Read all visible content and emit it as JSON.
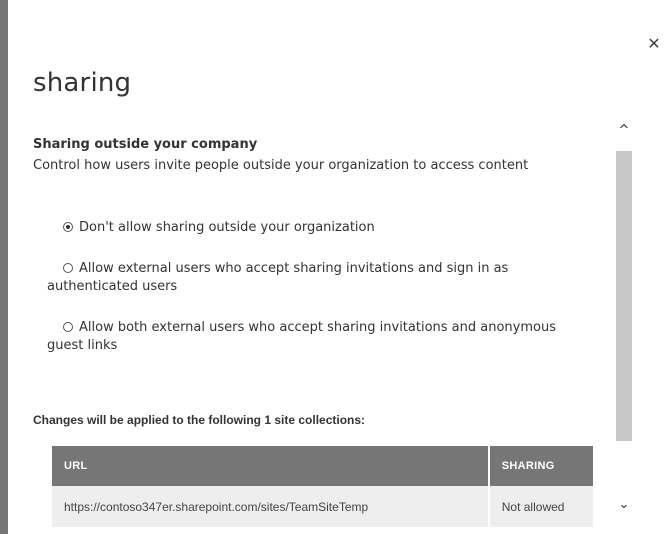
{
  "dialog": {
    "title": "sharing",
    "close_glyph": "✕"
  },
  "sharing_section": {
    "heading": "Sharing outside your company",
    "description": "Control how users invite people outside your organization to access content",
    "options": [
      {
        "label": "Don't allow sharing outside your organization",
        "selected": true
      },
      {
        "label": "Allow external users who accept sharing invitations and sign in as authenticated users",
        "selected": false
      },
      {
        "label": "Allow both external users who accept sharing invitations and anonymous guest links",
        "selected": false
      }
    ]
  },
  "site_collections": {
    "label": "Changes will be applied to the following 1 site collections:",
    "columns": [
      "URL",
      "SHARING"
    ],
    "rows": [
      {
        "url": "https://contoso347er.sharepoint.com/sites/TeamSiteTemp",
        "sharing": "Not allowed"
      }
    ]
  },
  "scrollbar": {
    "up_glyph": "^",
    "down_glyph": "⌄"
  },
  "colors": {
    "table_header_bg": "#767676",
    "table_row_bg": "#eeeeee",
    "left_bar": "#767676",
    "scroll_thumb": "#c8c8c8"
  }
}
